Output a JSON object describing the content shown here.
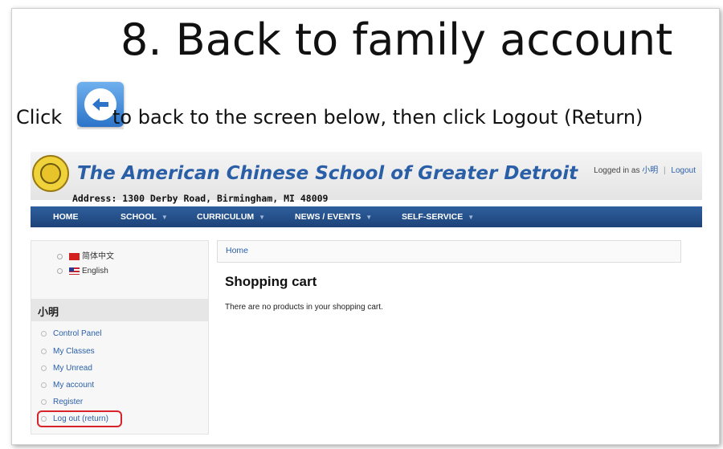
{
  "slide": {
    "title": "8. Back to family account",
    "instruction_pre": "Click",
    "instruction_post": "to back to the screen below, then click Logout (Return)"
  },
  "site": {
    "name": "The American Chinese School of Greater Detroit",
    "address": "Address: 1300 Derby Road, Birmingham, MI 48009",
    "logged_in_label": "Logged in as",
    "user": "小明",
    "logout": "Logout"
  },
  "nav": {
    "items": [
      {
        "label": "HOME",
        "caret": ""
      },
      {
        "label": "SCHOOL",
        "caret": "▼"
      },
      {
        "label": "CURRICULUM",
        "caret": "▼"
      },
      {
        "label": "NEWS / EVENTS",
        "caret": "▼"
      },
      {
        "label": "SELF-SERVICE",
        "caret": "▼"
      }
    ]
  },
  "languages": [
    {
      "label": "简体中文",
      "flag": "cn-flag-icon"
    },
    {
      "label": "English",
      "flag": "us-flag-icon"
    }
  ],
  "user_block": {
    "title": "小明",
    "items": [
      "Control Panel",
      "My Classes",
      "My Unread",
      "My account",
      "Register",
      "Log out (return)"
    ]
  },
  "main": {
    "breadcrumb": "Home",
    "heading": "Shopping cart",
    "message": "There are no products in your shopping cart."
  },
  "colors": {
    "nav_bg": "#2e5f9e",
    "link": "#2a5fa8",
    "highlight_ring": "#d8232a"
  }
}
